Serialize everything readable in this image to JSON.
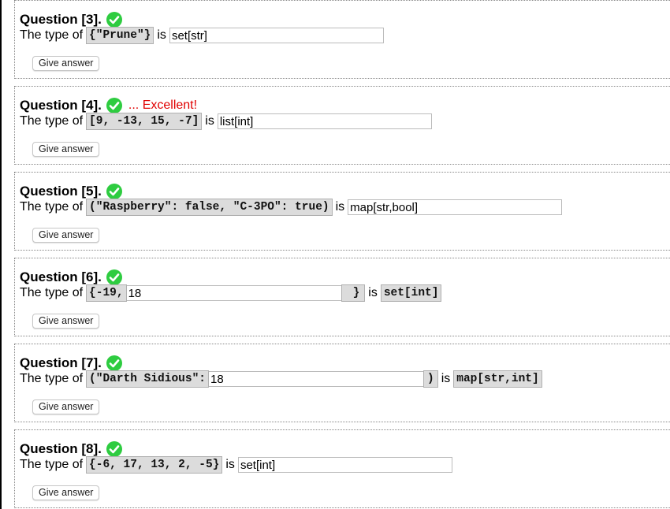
{
  "colors": {
    "check": "#2ecc40",
    "feedback": "#e00000",
    "code_bg": "#dcdcdc"
  },
  "questions": [
    {
      "title": "Question [3].",
      "feedback": "",
      "prefix": "The type of",
      "code": "{\"Prune\"}",
      "mid": "is",
      "answer": "set[str]",
      "button": "Give answer"
    },
    {
      "title": "Question [4].",
      "feedback": "... Excellent!",
      "prefix": "The type of",
      "code": "[9, -13, 15, -7]",
      "mid": "is",
      "answer": "list[int]",
      "button": "Give answer"
    },
    {
      "title": "Question [5].",
      "feedback": "",
      "prefix": "The type of",
      "code": "(\"Raspberry\": false, \"C-3PO\": true)",
      "mid": "is",
      "answer": "map[str,bool]",
      "button": "Give answer"
    },
    {
      "title": "Question [6].",
      "feedback": "",
      "prefix": "The type of",
      "code_start": "{-19,",
      "answer": "18",
      "code_end": "}",
      "mid": "is",
      "type_code": "set[int]",
      "button": "Give answer"
    },
    {
      "title": "Question [7].",
      "feedback": "",
      "prefix": "The type of",
      "code_start": "(\"Darth Sidious\":",
      "answer": "18",
      "code_end": ")",
      "mid": "is",
      "type_code": "map[str,int]",
      "button": "Give answer"
    },
    {
      "title": "Question [8].",
      "feedback": "",
      "prefix": "The type of",
      "code": "{-6, 17, 13, 2, -5}",
      "mid": "is",
      "answer": "set[int]",
      "button": "Give answer"
    }
  ]
}
